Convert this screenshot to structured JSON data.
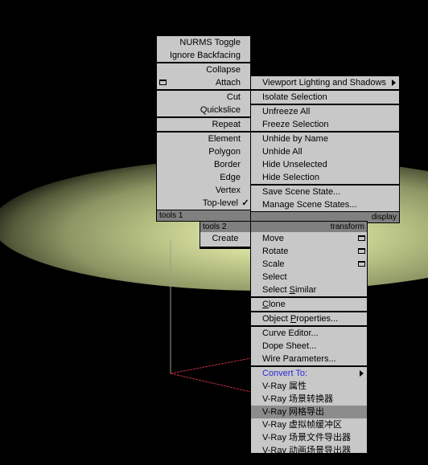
{
  "quad_left_top": {
    "items_a": [
      "NURMS Toggle",
      "Ignore Backfacing"
    ],
    "items_b": [
      "Collapse",
      "Attach"
    ],
    "items_c": [
      "Cut",
      "Quickslice"
    ],
    "items_d": [
      "Repeat"
    ],
    "items_e": [
      "Element",
      "Polygon",
      "Border",
      "Edge",
      "Vertex",
      "Top-level"
    ],
    "checked_item": "Top-level",
    "check_glyph": "✓",
    "header": "tools 1"
  },
  "quad_right_top": {
    "items_a": [
      "Viewport Lighting and Shadows"
    ],
    "items_b": [
      "Isolate Selection"
    ],
    "items_c": [
      "Unfreeze All",
      "Freeze Selection"
    ],
    "items_d": [
      "Unhide by Name",
      "Unhide All",
      "Hide Unselected",
      "Hide Selection"
    ],
    "items_e": [
      "Save Scene State...",
      "Manage Scene States..."
    ],
    "header": "display"
  },
  "quad_left_bottom": {
    "header": "tools 2",
    "items": [
      "Create"
    ]
  },
  "quad_right_bottom": {
    "header": "transform",
    "items_a": [
      "Move",
      "Rotate",
      "Scale",
      "Select",
      "Select Similar"
    ],
    "select_similar": {
      "pre": "Select ",
      "u": "S",
      "post": "imilar"
    },
    "clone": {
      "u": "C",
      "post": "lone"
    },
    "object_properties": {
      "pre": "Object ",
      "u": "P",
      "post": "roperties..."
    },
    "items_c": [
      "Curve Editor...",
      "Dope Sheet...",
      "Wire Parameters..."
    ],
    "convert_to": "Convert To:",
    "vray_items": [
      "V-Ray 属性",
      "V-Ray 场景转换器",
      "V-Ray 网格导出",
      "V-Ray 虚拟帧缓冲区",
      "V-Ray 场景文件导出器",
      "V-Ray 动画场景导出器"
    ],
    "highlighted": "V-Ray 网格导出"
  },
  "colors": {
    "menu_bg": "#c8c8c8",
    "header_bg": "#808080",
    "highlight": "#8c8c8c",
    "convert_to": "#2a2ad8",
    "wire_red": "#c03040"
  }
}
